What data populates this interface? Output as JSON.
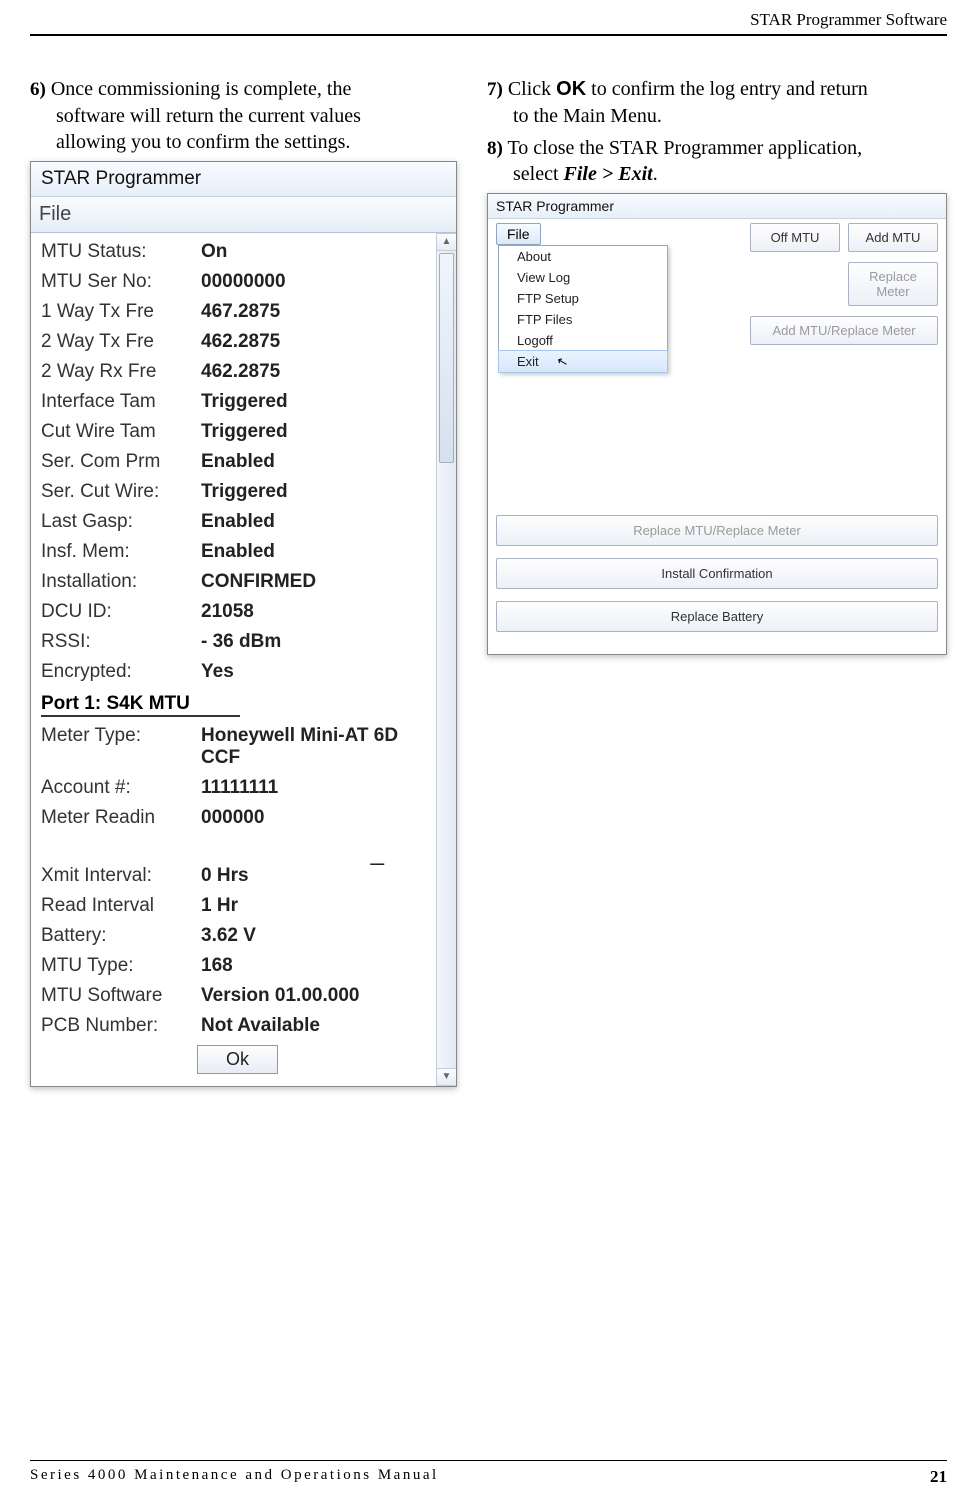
{
  "header": {
    "right": "STAR Programmer Software"
  },
  "steps": {
    "s6_num": "6)",
    "s6_line1": "Once commissioning is complete, the",
    "s6_line2": "software will return the current values",
    "s6_line3": "allowing you to confirm the settings.",
    "s7_num": "7)",
    "s7_a": "Click ",
    "s7_b": "OK",
    "s7_c": " to confirm the log entry and return",
    "s7_line2": "to the Main Menu.",
    "s8_num": "8)",
    "s8_a": "To close the STAR Programmer application,",
    "s8_b1": "select ",
    "s8_b2": "File > Exit",
    "s8_b3": "."
  },
  "win1": {
    "title": "STAR Programmer",
    "menu_file": "File",
    "rows": [
      {
        "lbl": "MTU Status:",
        "val": "On"
      },
      {
        "lbl": "MTU Ser No:",
        "val": "00000000"
      },
      {
        "lbl": "1 Way Tx Fre",
        "val": "467.2875"
      },
      {
        "lbl": "2 Way Tx Fre",
        "val": "462.2875"
      },
      {
        "lbl": "2 Way Rx Fre",
        "val": "462.2875"
      },
      {
        "lbl": "Interface Tam",
        "val": "Triggered"
      },
      {
        "lbl": "Cut Wire Tam",
        "val": "Triggered"
      },
      {
        "lbl": "Ser. Com Prm",
        "val": "Enabled"
      },
      {
        "lbl": "Ser. Cut Wire:",
        "val": "Triggered"
      },
      {
        "lbl": "Last Gasp:",
        "val": "Enabled"
      },
      {
        "lbl": "Insf. Mem:",
        "val": "Enabled"
      },
      {
        "lbl": "Installation:",
        "val": "CONFIRMED"
      },
      {
        "lbl": "DCU ID:",
        "val": "21058"
      },
      {
        "lbl": "RSSI:",
        "val": "- 36 dBm"
      },
      {
        "lbl": "Encrypted:",
        "val": "Yes"
      }
    ],
    "port_header": "Port 1: S4K MTU",
    "rows2": [
      {
        "lbl": "Meter Type:",
        "val": "Honeywell Mini-AT 6D CCF"
      },
      {
        "lbl": "Account #:",
        "val": "11111111"
      },
      {
        "lbl": "Meter Readin",
        "val": "000000"
      }
    ],
    "dash": "_",
    "rows3": [
      {
        "lbl": "Xmit Interval:",
        "val": "0 Hrs"
      },
      {
        "lbl": "Read Interval",
        "val": "1 Hr"
      },
      {
        "lbl": "Battery:",
        "val": "3.62 V"
      },
      {
        "lbl": "MTU Type:",
        "val": "168"
      },
      {
        "lbl": "MTU Software",
        "val": "Version 01.00.000"
      },
      {
        "lbl": "PCB Number:",
        "val": "Not Available"
      }
    ],
    "ok": "Ok"
  },
  "win2": {
    "title": "STAR Programmer",
    "file": "File",
    "menu": [
      "About",
      "View Log",
      "FTP Setup",
      "FTP Files",
      "Logoff",
      "Exit"
    ],
    "hover_index": 5,
    "top_btn1": "Off MTU",
    "top_btn2": "Add MTU",
    "btn_replace_meter": "Replace Meter",
    "btn_add_replace": "Add MTU/Replace Meter",
    "btn_replace_mtu_meter": "Replace MTU/Replace Meter",
    "btn_install_confirm": "Install Confirmation",
    "btn_replace_battery": "Replace Battery"
  },
  "footer": {
    "left": "Series 4000 Maintenance and Operations Manual",
    "right": "21"
  }
}
